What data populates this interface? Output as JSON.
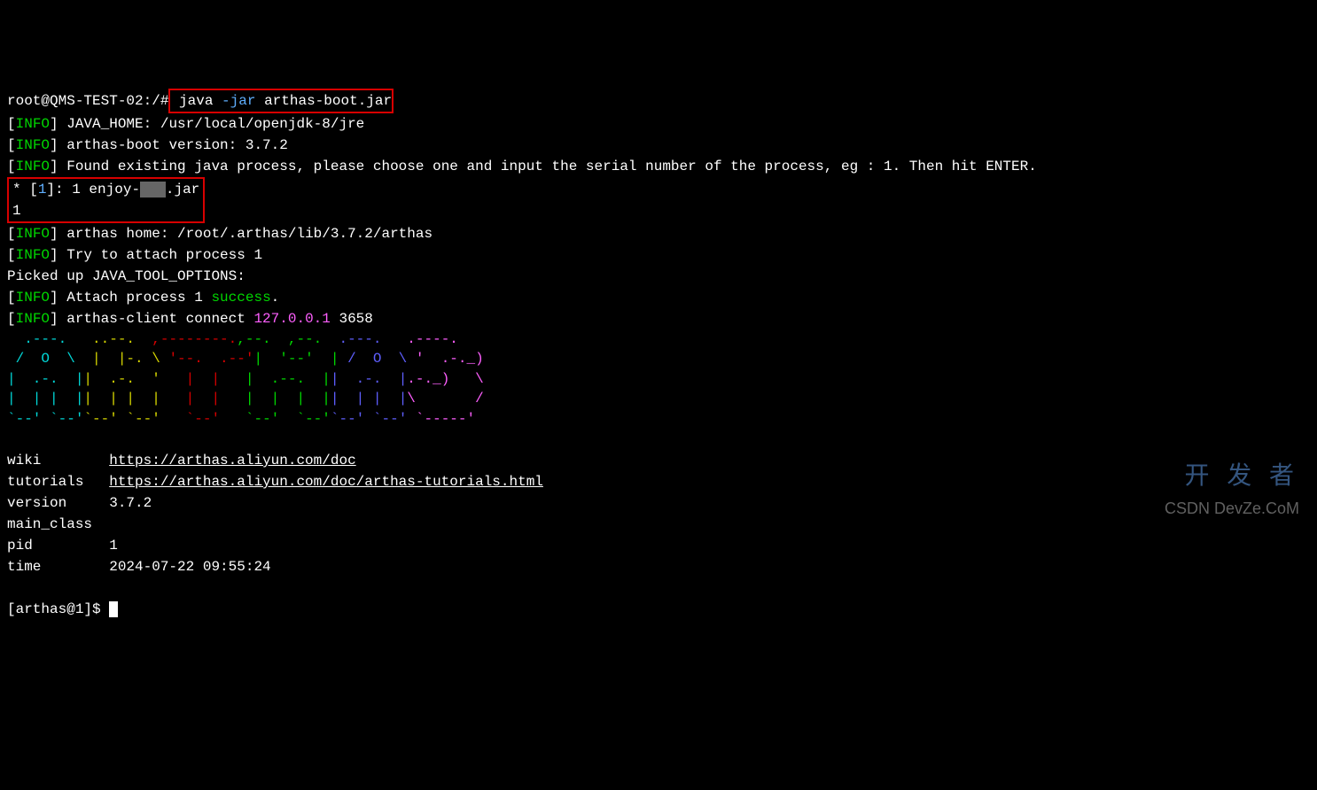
{
  "prompt": {
    "user_host": "root@QMS-TEST-02",
    "path": ":/#",
    "command_java": " java",
    "command_flag": " -jar",
    "command_arg": " arthas-boot.jar"
  },
  "lines": {
    "java_home": "] JAVA_HOME: /usr/local/openjdk-8/jre",
    "boot_version": "] arthas-boot version: 3.7.2",
    "found_process": "] Found existing java process, please choose one and input the serial number of the process, eg : 1. Then hit ENTER.",
    "process_prefix": "* [",
    "process_num": "1",
    "process_suffix": "]: 1 enjoy-",
    "process_jar": ".jar",
    "user_input": "1",
    "arthas_home": "] arthas home: /root/.arthas/lib/3.7.2/arthas",
    "try_attach": "] Try to attach process 1",
    "picked_up": "Picked up JAVA_TOOL_OPTIONS:",
    "attach_prefix": "] Attach process 1 ",
    "attach_success": "success",
    "attach_suffix": ".",
    "client_connect_prefix": "] arthas-client connect ",
    "client_ip": "127.0.0.1",
    "client_port": " 3658"
  },
  "info_label": "INFO",
  "ascii": {
    "l1_a": "  .---. ",
    "l1_b": "  ..--.  ",
    "l1_c": ",--------.",
    "l1_d": ",--.  ,--.",
    "l1_e": "  .---. ",
    "l1_f": "  .----. ",
    "l2_a": " /  O  \\ ",
    "l2_b": " |  |-. \\ ",
    "l2_c": "'--.  .--'",
    "l2_d": "|  '--'  |",
    "l2_e": " /  O  \\ ",
    "l2_f": "'  .-._) ",
    "l3_a": "|  .-.  |",
    "l3_b": "|  .-.  '",
    "l3_c": "   |  |   ",
    "l3_d": "|  .--.  |",
    "l3_e": "|  .-.  |",
    "l3_f": ".-._)   \\",
    "l4_a": "|  | |  |",
    "l4_b": "|  | |  |",
    "l4_c": "   |  |   ",
    "l4_d": "|  |  |  |",
    "l4_e": "|  | |  |",
    "l4_f": "\\       /",
    "l5_a": "`--' `--'",
    "l5_b": "`--' `--'",
    "l5_c": "   `--'   ",
    "l5_d": "`--'  `--'",
    "l5_e": "`--' `--'",
    "l5_f": " `-----' "
  },
  "info_table": {
    "wiki_label": "wiki      ",
    "wiki_url": "https://arthas.aliyun.com/doc",
    "tutorials_label": "tutorials ",
    "tutorials_url": "https://arthas.aliyun.com/doc/arthas-tutorials.html",
    "version_label": "version   ",
    "version_value": "3.7.2",
    "mainclass_label": "main_class",
    "pid_label": "pid       ",
    "pid_value": "1",
    "time_label": "time      ",
    "time_value": "2024-07-22 09:55:24"
  },
  "arthas_prompt": "[arthas@1]$",
  "watermarks": {
    "w1": "开 发 者",
    "w2": "CSDN DevZe.CoM"
  }
}
